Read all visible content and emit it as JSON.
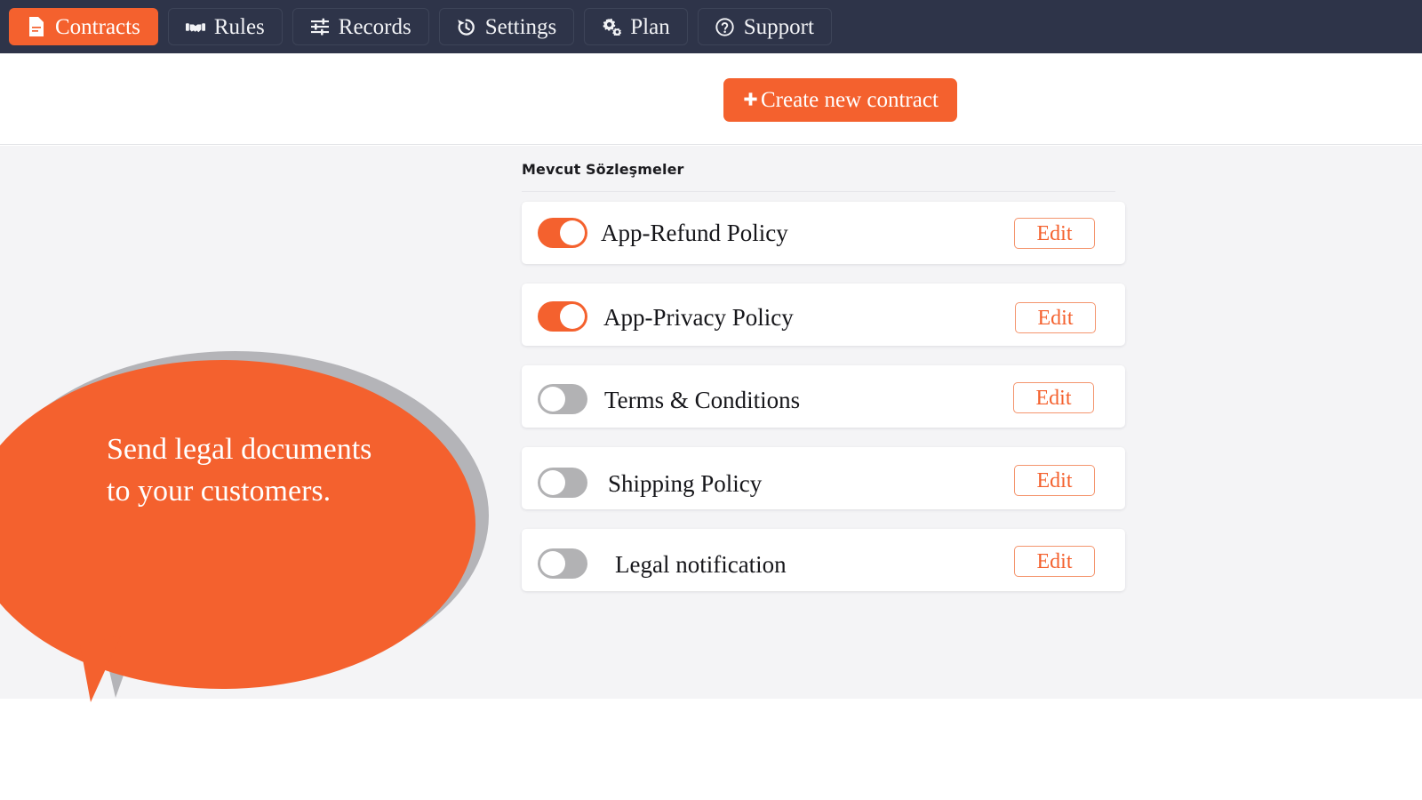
{
  "nav": {
    "items": [
      {
        "label": "Contracts",
        "icon": "file-contract-icon",
        "active": true
      },
      {
        "label": "Rules",
        "icon": "handshake-icon",
        "active": false
      },
      {
        "label": "Records",
        "icon": "sliders-icon",
        "active": false
      },
      {
        "label": "Settings",
        "icon": "history-clock-icon",
        "active": false
      },
      {
        "label": "Plan",
        "icon": "cogs-icon",
        "active": false
      },
      {
        "label": "Support",
        "icon": "question-circle-icon",
        "active": false
      }
    ]
  },
  "header": {
    "create_button_label": "Create new contract",
    "create_button_icon": "plus-icon"
  },
  "main": {
    "section_title": "Mevcut Sözleşmeler",
    "edit_label": "Edit",
    "rows": [
      {
        "label": "App-Refund Policy",
        "enabled": true
      },
      {
        "label": "App-Privacy Policy",
        "enabled": true
      },
      {
        "label": "Terms & Conditions",
        "enabled": false
      },
      {
        "label": "Shipping Policy",
        "enabled": false
      },
      {
        "label": "Legal notification",
        "enabled": false
      }
    ]
  },
  "callout": {
    "text": "Send legal documents to your customers."
  },
  "colors": {
    "accent": "#f4612e",
    "navbar": "#2e3449",
    "content_bg": "#f4f4f6",
    "toggle_off": "#b2b2b4",
    "callout_shadow": "#b4b4b8"
  }
}
